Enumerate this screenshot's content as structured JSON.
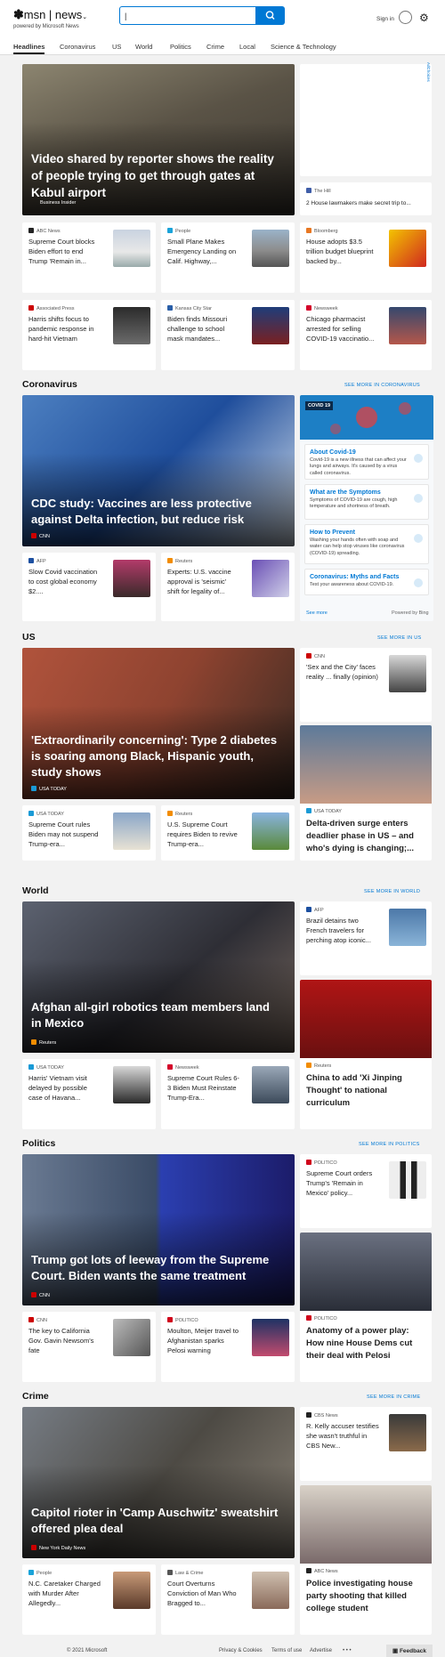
{
  "header": {
    "logo": "msn",
    "section": "news",
    "powered_by": "powered by Microsoft News",
    "search_value": "|",
    "signin": "Sign in"
  },
  "nav": [
    "Headlines",
    "Coronavirus",
    "US",
    "World",
    "Politics",
    "Crime",
    "Local",
    "Science & Technology"
  ],
  "headlines": {
    "hero": {
      "title": "Video shared by reporter shows the reality of people trying to get through gates at Kabul airport",
      "source": "Business Insider"
    },
    "ad_label": "AdChoices",
    "side_source": "The Hill",
    "side_title": "2 House lawmakers make secret trip to...",
    "cards": [
      {
        "source": "ABC News",
        "title": "Supreme Court blocks Biden effort to end Trump 'Remain in..."
      },
      {
        "source": "People",
        "title": "Small Plane Makes Emergency Landing on Calif. Highway,..."
      },
      {
        "source": "Bloomberg",
        "title": "House adopts $3.5 trillion budget blueprint backed by..."
      },
      {
        "source": "Associated Press",
        "title": "Harris shifts focus to pandemic response in hard-hit Vietnam"
      },
      {
        "source": "Kansas City Star",
        "title": "Biden finds Missouri challenge to school mask mandates..."
      },
      {
        "source": "Newsweek",
        "title": "Chicago pharmacist arrested for selling COVID-19 vaccinatio..."
      }
    ]
  },
  "coronavirus": {
    "heading": "Coronavirus",
    "see_more": "SEE MORE IN CORONAVIRUS",
    "hero": {
      "title": "CDC study: Vaccines are less protective against Delta infection, but reduce risk",
      "source": "CNN"
    },
    "panel": {
      "tag": "COVID 19",
      "items": [
        {
          "h": "About Covid-19",
          "d": "Covid-19 is a new illness that can affect your lungs and airways. It's caused by a virus called coronavirus."
        },
        {
          "h": "What are the Symptoms",
          "d": "Symptoms of COVID-19 are cough, high temperature and shortness of breath."
        },
        {
          "h": "How to Prevent",
          "d": "Washing your hands often with soap and water can help stop viruses like coronavirus (COVID-19) spreading."
        },
        {
          "h": "Coronavirus: Myths and Facts",
          "d": "Test your awareness about COVID-19."
        }
      ],
      "see_more": "See more",
      "powered": "Powered by Bing"
    },
    "cards": [
      {
        "source": "AFP",
        "title": "Slow Covid vaccination to cost global economy $2...."
      },
      {
        "source": "Reuters",
        "title": "Experts: U.S. vaccine approval is 'seismic' shift for legality of..."
      }
    ]
  },
  "us": {
    "heading": "US",
    "see_more": "SEE MORE IN US",
    "hero": {
      "title": "'Extraordinarily concerning': Type 2 diabetes is soaring among Black, Hispanic youth, study shows",
      "source": "USA TODAY"
    },
    "side": {
      "source": "CNN",
      "title": "'Sex and the City' faces reality ... finally (opinion)"
    },
    "big": {
      "source": "USA TODAY",
      "title": "Delta-driven surge enters deadlier phase in US – and who's dying is changing;..."
    },
    "cards": [
      {
        "source": "USA TODAY",
        "title": "Supreme Court rules Biden may not suspend Trump-era..."
      },
      {
        "source": "Reuters",
        "title": "U.S. Supreme Court requires Biden to revive Trump-era..."
      }
    ]
  },
  "world": {
    "heading": "World",
    "see_more": "SEE MORE IN WORLD",
    "hero": {
      "title": "Afghan all-girl robotics team members land in Mexico",
      "source": "Reuters"
    },
    "side": {
      "source": "AFP",
      "title": "Brazil detains two French travelers for perching atop iconic..."
    },
    "big": {
      "source": "Reuters",
      "title": "China to add 'Xi Jinping Thought' to national curriculum"
    },
    "cards": [
      {
        "source": "USA TODAY",
        "title": "Harris' Vietnam visit delayed by possible case of Havana..."
      },
      {
        "source": "Newsweek",
        "title": "Supreme Court Rules 6-3 Biden Must Reinstate Trump-Era..."
      }
    ]
  },
  "politics": {
    "heading": "Politics",
    "see_more": "SEE MORE IN POLITICS",
    "hero": {
      "title": "Trump got lots of leeway from the Supreme Court. Biden wants the same treatment",
      "source": "CNN"
    },
    "side": {
      "source": "POLITICO",
      "title": "Supreme Court orders Trump's 'Remain in Mexico' policy..."
    },
    "big": {
      "source": "POLITICO",
      "title": "Anatomy of a power play: How nine House Dems cut their deal with Pelosi"
    },
    "cards": [
      {
        "source": "CNN",
        "title": "The key to California Gov. Gavin Newsom's fate"
      },
      {
        "source": "POLITICO",
        "title": "Moulton, Meijer travel to Afghanistan sparks Pelosi warning"
      }
    ]
  },
  "crime": {
    "heading": "Crime",
    "see_more": "SEE MORE IN CRIME",
    "hero": {
      "title": "Capitol rioter in 'Camp Auschwitz' sweatshirt offered plea deal",
      "source": "New York Daily News"
    },
    "side": {
      "source": "CBS News",
      "title": "R. Kelly accuser testifies she wasn't truthful in CBS New..."
    },
    "big": {
      "source": "ABC News",
      "title": "Police investigating house party shooting that killed college student"
    },
    "cards": [
      {
        "source": "People",
        "title": "N.C. Caretaker Charged with Murder After Allegedly..."
      },
      {
        "source": "Law & Crime",
        "title": "Court Overturns Conviction of Man Who Bragged to..."
      }
    ]
  },
  "footer": {
    "copyright": "© 2021 Microsoft",
    "privacy": "Privacy & Cookies",
    "terms": "Terms of use",
    "advertise": "Advertise",
    "more": "• • •",
    "feedback": "Feedback"
  }
}
